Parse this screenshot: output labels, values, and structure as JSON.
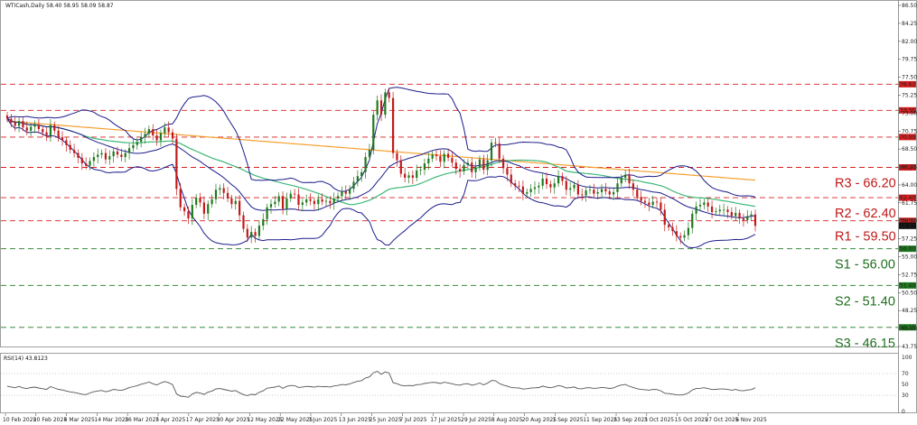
{
  "header": {
    "main_text": "WTICash,Daily  58.40 58.95 58.09 58.87",
    "rsi_text": "RSI(14) 43.8123"
  },
  "colors": {
    "resistance": "#d62020",
    "support": "#1e7a1e",
    "bollinger": "#1c1c8c",
    "ma_fast": "#3cb878",
    "ma_slow": "#f5a030",
    "bull_candle": "#1e7a1e",
    "bear_candle": "#c21a1a",
    "rsi_line": "#555555"
  },
  "chart_data": [
    {
      "type": "candlestick",
      "series_name": "WTICash,Daily",
      "ylim": [
        43.75,
        86.5
      ],
      "y_ticks": [
        "86.50",
        "84.25",
        "82.00",
        "79.75",
        "77.50",
        "75.25",
        "73.00",
        "70.75",
        "68.50",
        "66.25",
        "64.00",
        "61.75",
        "59.50",
        "57.25",
        "55.00",
        "52.75",
        "50.50",
        "48.25",
        "46.00",
        "43.75"
      ],
      "x_ticks": [
        "10 Feb 2025",
        "20 Feb 2025",
        "4 Mar 2025",
        "14 Mar 2025",
        "26 Mar 2025",
        "7 Apr 2025",
        "17 Apr 2025",
        "30 Apr 2025",
        "12 May 2025",
        "22 May 2025",
        "3 Jun 2025",
        "13 Jun 2025",
        "25 Jun 2025",
        "7 Jul 2025",
        "17 Jul 2025",
        "29 Jul 2025",
        "8 Aug 2025",
        "20 Aug 2025",
        "1 Sep 2025",
        "11 Sep 2025",
        "23 Sep 2025",
        "3 Oct 2025",
        "15 Oct 2025",
        "27 Oct 2025",
        "6 Nov 2025"
      ],
      "levels": [
        {
          "name": "R3",
          "label": "R3 - 66.20",
          "value": 66.2,
          "kind": "resistance"
        },
        {
          "name": "R2",
          "label": "R2 - 62.40",
          "value": 62.4,
          "kind": "resistance"
        },
        {
          "name": "R1",
          "label": "R1 - 59.50",
          "value": 59.5,
          "kind": "resistance"
        },
        {
          "name": "S1",
          "label": "S1 - 56.00",
          "value": 56.0,
          "kind": "support"
        },
        {
          "name": "S2",
          "label": "S2 - 51.40",
          "value": 51.4,
          "kind": "support"
        },
        {
          "name": "S3",
          "label": "S3 - 46.15",
          "value": 46.15,
          "kind": "support"
        }
      ],
      "extra_lines": [
        {
          "label": "76.62",
          "value": 76.62
        },
        {
          "label": "73.35",
          "value": 73.35
        },
        {
          "label": "70.00",
          "value": 70.0
        }
      ],
      "price_tags": [
        {
          "label": "76.62",
          "value": 76.62,
          "color": "#d62020"
        },
        {
          "label": "73.35",
          "value": 73.35,
          "color": "#d62020"
        },
        {
          "label": "70.00",
          "value": 70.0,
          "color": "#d62020"
        },
        {
          "label": "66.20",
          "value": 66.2,
          "color": "#d62020"
        },
        {
          "label": "62.40",
          "value": 62.4,
          "color": "#d62020"
        },
        {
          "label": "59.50",
          "value": 59.5,
          "color": "#d62020"
        },
        {
          "label": "58.87",
          "value": 58.87,
          "color": "#111111"
        },
        {
          "label": "56.00",
          "value": 56.0,
          "color": "#1e7a1e"
        },
        {
          "label": "51.40",
          "value": 51.4,
          "color": "#1e7a1e"
        },
        {
          "label": "46.15",
          "value": 46.15,
          "color": "#1e7a1e"
        }
      ],
      "close": [
        72.3,
        71.8,
        71.4,
        72.0,
        71.2,
        70.8,
        71.3,
        71.5,
        71.0,
        70.6,
        70.2,
        71.5,
        70.8,
        70.0,
        69.6,
        69.0,
        68.4,
        68.0,
        67.4,
        66.7,
        66.4,
        67.0,
        67.5,
        67.8,
        68.0,
        67.2,
        67.6,
        68.2,
        67.8,
        67.5,
        68.0,
        68.6,
        69.0,
        69.4,
        70.0,
        70.4,
        71.0,
        70.2,
        69.6,
        70.5,
        71.2,
        70.6,
        69.8,
        63.5,
        61.2,
        60.7,
        59.8,
        61.5,
        62.4,
        61.8,
        60.4,
        61.6,
        62.2,
        63.4,
        63.6,
        63.0,
        62.3,
        61.6,
        62.0,
        60.2,
        58.5,
        57.4,
        58.1,
        57.6,
        58.9,
        59.7,
        61.2,
        61.6,
        61.9,
        62.6,
        61.0,
        62.3,
        62.9,
        62.8,
        61.5,
        61.8,
        62.2,
        62.0,
        61.6,
        62.2,
        61.9,
        62.0,
        61.7,
        62.3,
        62.6,
        63.2,
        62.9,
        63.5,
        64.4,
        65.1,
        65.6,
        67.5,
        68.4,
        72.8,
        74.6,
        72.8,
        75.6,
        74.9,
        68.0,
        67.1,
        65.4,
        64.9,
        65.2,
        64.9,
        65.8,
        65.9,
        66.7,
        67.3,
        67.8,
        67.6,
        66.9,
        67.9,
        67.4,
        66.8,
        66.0,
        65.7,
        66.5,
        66.8,
        65.6,
        66.2,
        67.2,
        65.9,
        67.1,
        69.3,
        69.2,
        67.3,
        66.1,
        65.3,
        64.2,
        63.9,
        63.8,
        62.9,
        63.1,
        63.5,
        63.7,
        63.9,
        64.8,
        64.1,
        63.7,
        64.2,
        65.1,
        64.5,
        63.4,
        63.6,
        64.0,
        62.8,
        62.7,
        63.3,
        63.4,
        62.9,
        63.1,
        63.5,
        63.2,
        62.8,
        63.1,
        64.2,
        64.9,
        65.3,
        64.2,
        63.4,
        62.5,
        62.0,
        61.8,
        61.5,
        61.9,
        61.8,
        60.9,
        59.0,
        58.7,
        58.2,
        57.6,
        57.4,
        57.7,
        58.6,
        60.4,
        61.3,
        61.5,
        61.8,
        61.3,
        60.6,
        60.7,
        60.9,
        60.9,
        60.6,
        60.1,
        60.5,
        59.8,
        59.6,
        60.1,
        60.3,
        58.87
      ],
      "indicators": [
        "Bollinger Bands (20,2)",
        "MA 100",
        "MA 200"
      ]
    },
    {
      "type": "line",
      "series_name": "RSI(14)",
      "ylim": [
        0,
        100
      ],
      "y_ticks": [
        "100",
        "70",
        "50",
        "30",
        "0"
      ],
      "last_value": 43.8123,
      "values": [
        46.8,
        45.2,
        43.9,
        46.3,
        43.5,
        42.4,
        44.2,
        45.0,
        43.3,
        42.0,
        40.9,
        45.8,
        43.4,
        40.8,
        39.6,
        37.9,
        36.2,
        35.2,
        33.6,
        31.8,
        31.1,
        34.1,
        36.5,
        37.9,
        38.8,
        36.3,
        38.0,
        40.9,
        39.7,
        38.8,
        41.2,
        44.0,
        45.9,
        47.7,
        50.3,
        52.0,
        54.5,
        51.2,
        48.8,
        52.6,
        55.4,
        53.0,
        49.7,
        32.5,
        28.4,
        27.6,
        26.2,
        32.1,
        35.1,
        34.0,
        31.5,
        35.6,
        37.7,
        41.7,
        42.4,
        40.9,
        39.2,
        37.5,
        38.7,
        34.5,
        31.2,
        29.3,
        31.7,
        30.9,
        35.4,
        38.1,
        42.9,
        44.0,
        45.0,
        47.1,
        42.7,
        46.4,
        48.0,
        47.7,
        44.3,
        45.2,
        46.4,
        45.8,
        44.8,
        46.5,
        45.7,
        46.0,
        45.2,
        47.1,
        48.0,
        49.9,
        49.1,
        50.9,
        53.6,
        55.6,
        57.0,
        61.8,
        63.8,
        71.5,
        74.1,
        68.6,
        73.2,
        70.9,
        53.2,
        51.4,
        48.2,
        47.3,
        48.0,
        47.5,
        49.5,
        49.8,
        51.6,
        52.8,
        53.9,
        53.4,
        51.7,
        54.0,
        52.7,
        51.2,
        49.3,
        48.6,
        50.6,
        51.3,
        48.5,
        50.0,
        52.5,
        49.2,
        52.3,
        57.2,
        56.9,
        51.6,
        48.6,
        46.8,
        44.3,
        43.6,
        43.4,
        41.4,
        42.0,
        43.1,
        43.6,
        44.2,
        46.8,
        45.0,
        43.9,
        45.4,
        48.0,
        46.3,
        43.4,
        44.0,
        45.2,
        42.1,
        41.9,
        43.6,
        43.9,
        42.6,
        43.2,
        44.4,
        43.6,
        42.5,
        43.5,
        46.8,
        48.8,
        49.9,
        46.6,
        44.4,
        42.0,
        40.7,
        40.2,
        39.4,
        40.7,
        40.5,
        38.1,
        33.7,
        33.0,
        32.0,
        30.7,
        30.3,
        31.4,
        34.2,
        39.7,
        42.3,
        42.9,
        43.8,
        42.4,
        40.5,
        40.8,
        41.5,
        41.5,
        40.7,
        39.3,
        40.6,
        38.7,
        38.2,
        39.7,
        40.4,
        43.8123
      ]
    }
  ]
}
